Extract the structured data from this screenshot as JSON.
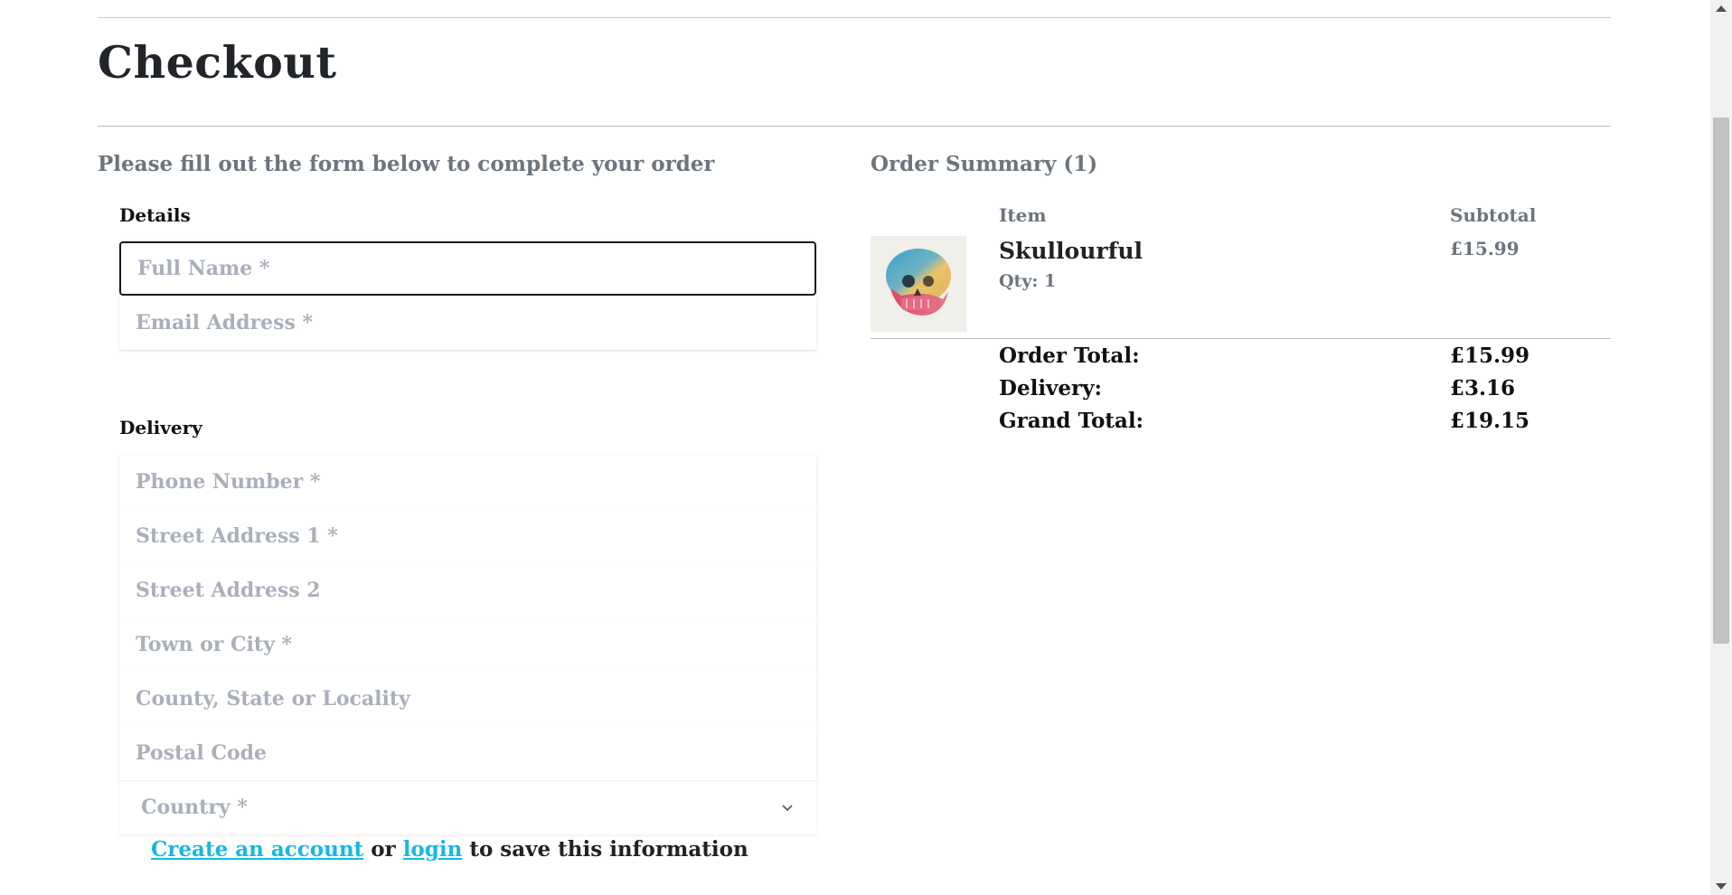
{
  "page": {
    "title": "Checkout"
  },
  "form": {
    "heading": "Please fill out the form below to complete your order",
    "details": {
      "legend": "Details",
      "full_name": {
        "placeholder": "Full Name *",
        "value": ""
      },
      "email": {
        "placeholder": "Email Address *",
        "value": ""
      }
    },
    "delivery": {
      "legend": "Delivery",
      "phone": {
        "placeholder": "Phone Number *"
      },
      "street1": {
        "placeholder": "Street Address 1 *"
      },
      "street2": {
        "placeholder": "Street Address 2"
      },
      "town": {
        "placeholder": "Town or City *"
      },
      "county": {
        "placeholder": "County, State or Locality"
      },
      "postcode": {
        "placeholder": "Postal Code"
      },
      "country": {
        "selected": "Country *"
      }
    },
    "account": {
      "create_link": "Create an account",
      "or_text": "or",
      "login_link": "login",
      "suffix": "to save this information",
      "link_color": "#17b8e0"
    }
  },
  "summary": {
    "heading": "Order Summary (1)",
    "columns": {
      "item": "Item",
      "subtotal": "Subtotal"
    },
    "items": [
      {
        "name": "Skullourful",
        "qty": "Qty: 1",
        "subtotal": "£15.99",
        "image_icon": "skull-image"
      }
    ],
    "totals": {
      "order_total_label": "Order Total:",
      "order_total": "£15.99",
      "delivery_label": "Delivery:",
      "delivery": "£3.16",
      "grand_total_label": "Grand Total:",
      "grand_total": "£19.15"
    }
  }
}
